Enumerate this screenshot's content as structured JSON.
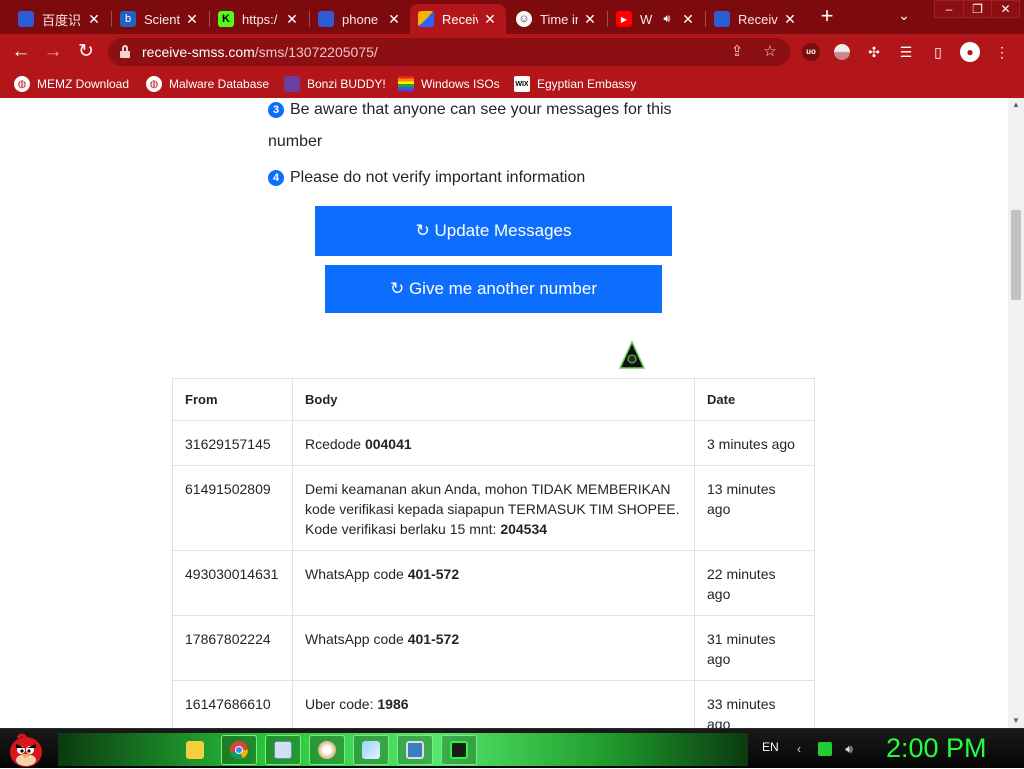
{
  "browser": {
    "tabs": [
      {
        "title": "百度识",
        "favicon": "baidu-paw",
        "active": false
      },
      {
        "title": "Scientu",
        "favicon": "bing",
        "active": false
      },
      {
        "title": "https:/",
        "favicon": "kick",
        "active": false
      },
      {
        "title": "phone",
        "favicon": "baidu-paw",
        "active": false
      },
      {
        "title": "Receiv",
        "favicon": "receive-smss",
        "active": true
      },
      {
        "title": "Time ir",
        "favicon": "time-smiley",
        "active": false
      },
      {
        "title": "W",
        "favicon": "youtube",
        "active": false
      },
      {
        "title": "Receiv",
        "favicon": "baidu-paw",
        "active": false
      }
    ],
    "close_glyph": "✕",
    "new_tab_glyph": "+",
    "tab_search_glyph": "⌄",
    "window_controls": [
      "–",
      "❐",
      "✕"
    ],
    "url_host": "receive-smss.com",
    "url_path": "/sms/13072205075/",
    "accent_color": "#b2151a"
  },
  "bookmarks": [
    {
      "label": "MEMZ Download",
      "icon": "globe"
    },
    {
      "label": "Malware Database",
      "icon": "globe"
    },
    {
      "label": "Bonzi BUDDY!",
      "icon": "bonzi"
    },
    {
      "label": "Windows ISOs",
      "icon": "rainbow"
    },
    {
      "label": "Egyptian Embassy",
      "icon": "wix"
    }
  ],
  "page": {
    "bullet3_num": "3",
    "bullet3_line1": "Be aware that anyone can see your messages for this",
    "bullet3_line2": "number",
    "bullet4_num": "4",
    "bullet4_text": "Please do not verify important information",
    "update_button": "↻ Update Messages",
    "another_number_button": "↻ Give me another number",
    "table": {
      "headers": {
        "from": "From",
        "body": "Body",
        "date": "Date"
      },
      "rows": [
        {
          "from": "31629157145",
          "body_text": "Rcedode ",
          "code": "004041",
          "date": "3 minutes ago"
        },
        {
          "from": "61491502809",
          "body_text": "Demi keamanan akun Anda, mohon TIDAK MEMBERIKAN kode verifikasi kepada siapapun TERMASUK TIM SHOPEE. Kode verifikasi berlaku 15 mnt: ",
          "code": "204534",
          "date": "13 minutes ago"
        },
        {
          "from": "493030014631",
          "body_text": "WhatsApp code ",
          "code": "401-572",
          "date": "22 minutes ago"
        },
        {
          "from": "17867802224",
          "body_text": "WhatsApp code ",
          "code": "401-572",
          "date": "31 minutes ago"
        },
        {
          "from": "16147686610",
          "body_text": "Uber code: ",
          "code": "1986",
          "date": "33 minutes ago"
        }
      ]
    }
  },
  "taskbar": {
    "language": "EN",
    "clock": "2:00 PM",
    "clock_color": "#22ff3a",
    "pinned": [
      "folder",
      "chrome",
      "notepad",
      "paint",
      "network",
      "display",
      "terminal"
    ]
  }
}
